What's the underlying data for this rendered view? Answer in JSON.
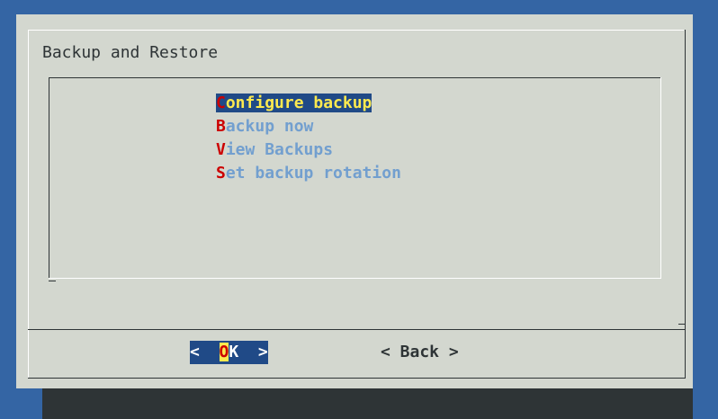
{
  "dialog": {
    "title": "Backup and Restore",
    "menu": [
      {
        "hotkey": "C",
        "rest": "onfigure backup",
        "selected": true
      },
      {
        "hotkey": "B",
        "rest": "ackup now",
        "selected": false
      },
      {
        "hotkey": "V",
        "rest": "iew Backups",
        "selected": false
      },
      {
        "hotkey": "S",
        "rest": "et backup rotation",
        "selected": false
      }
    ],
    "buttons": {
      "ok": {
        "left": "<  ",
        "hotkey": "O",
        "rest": "K",
        "right": "  >"
      },
      "back": "< Back >"
    }
  },
  "colors": {
    "desktop_bg": "#3465a4",
    "dialog_bg": "#d3d7cf",
    "selection_bg": "#204a87",
    "selection_fg": "#fce94f",
    "hotkey": "#cc0000",
    "item_fg": "#729fcf"
  }
}
